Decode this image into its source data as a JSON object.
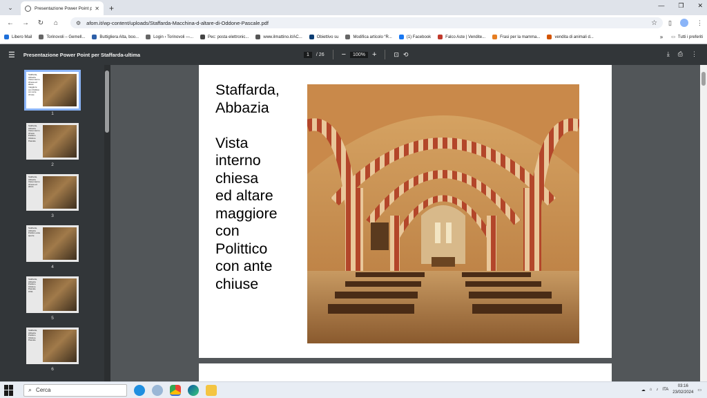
{
  "browser": {
    "tab_title": "Presentazione Power Point per ...",
    "tab_close": "✕",
    "new_tab": "+",
    "url": "afom.it/wp-content/uploads/Staffarda-Macchina-d-altare-di-Oddone-Pascale.pdf"
  },
  "bookmarks": [
    {
      "label": "Libero Mail",
      "color": "#1e6fd9"
    },
    {
      "label": "Torinovoli – Gemell...",
      "color": "#666666"
    },
    {
      "label": "Buttigliera Alta, boo...",
      "color": "#2d5fa8"
    },
    {
      "label": "Login ‹ Torinovoli —...",
      "color": "#666666"
    },
    {
      "label": "Pec: posta elettronic...",
      "color": "#444444"
    },
    {
      "label": "www.ilmattino.it/AC...",
      "color": "#555555"
    },
    {
      "label": "Obiettivo su",
      "color": "#0b3d73"
    },
    {
      "label": "Modifica articolo “R...",
      "color": "#666666"
    },
    {
      "label": "(1) Facebook",
      "color": "#1877f2"
    },
    {
      "label": "Falco Aste | Vendite...",
      "color": "#c0392b"
    },
    {
      "label": "Frasi per la mamma...",
      "color": "#e67e22"
    },
    {
      "label": "vendita di animali d...",
      "color": "#d35400"
    }
  ],
  "bookmarks_more": "»",
  "bookmarks_folder": "Tutti i preferiti",
  "pdf": {
    "title": "Presentazione Power Point per Staffarda-ultima",
    "current_page": "1",
    "total_pages": "/ 26",
    "zoom": "100%"
  },
  "thumbnails": [
    {
      "number": "1",
      "text": "Staffarda, Abbazia Vista interno chiesa ed altare maggiore con Polittico con ante chiuse"
    },
    {
      "number": "2",
      "text": "Staffarda, Abbazia Vista interno chiesa Polittico Oddone Pascale"
    },
    {
      "number": "3",
      "text": "Staffarda, Abbazia Vista interno chiesa ed altare"
    },
    {
      "number": "4",
      "text": "Staffarda, Abbazia Polittico ante aperte"
    },
    {
      "number": "5",
      "text": "Staffarda, Abbazia Polittico Oddone Pascale 1531"
    },
    {
      "number": "6",
      "text": "Staffarda, Abbazia Polittico Oddone Pascale"
    }
  ],
  "slide": {
    "text": "Staffarda,\nAbbazia\n\nVista\ninterno\nchiesa\ned altare\nmaggiore\ncon\nPolittico\ncon ante\nchiuse"
  },
  "taskbar": {
    "search_placeholder": "Cerca",
    "language": "ITA",
    "time": "03:16",
    "date": "23/02/2024"
  },
  "colors": {
    "pdf_toolbar": "#323639",
    "viewer_bg": "#525659",
    "accent": "#8ab4f8"
  }
}
